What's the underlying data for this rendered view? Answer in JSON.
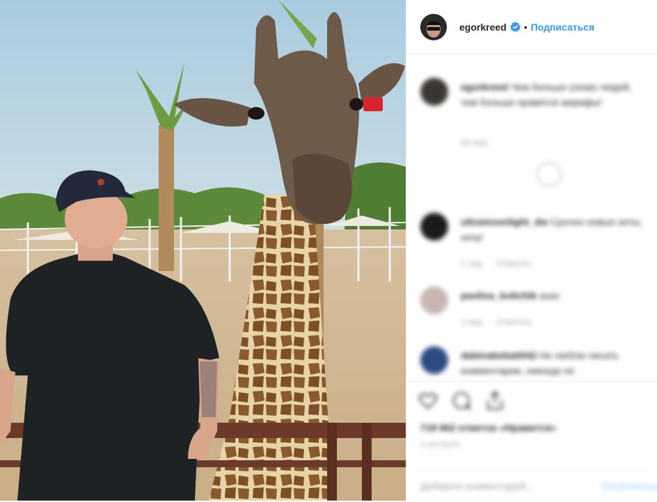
{
  "post": {
    "image_alt": "Man in black cap and t-shirt standing next to a giraffe at a zoo",
    "colors": {
      "accent": "#3897f0",
      "sky": "#bcd6e3",
      "ground": "#d2b48c"
    }
  },
  "header": {
    "username": "egorkreed",
    "verified_icon": "verified-badge-icon",
    "separator": "•",
    "follow_label": "Подписаться"
  },
  "comments": [
    {
      "user": "egorkreed",
      "text": "Чем больше узнаю людей, тем больше нравятся жирафы!",
      "meta_time": "33 нед."
    },
    {
      "user": "ultramoonlight_dw",
      "text": "Срочно новые хиты, хочу!",
      "meta_time": "1 нед.",
      "meta_reply": "Ответить"
    },
    {
      "user": "pavlina_koltchik",
      "text": "ахах",
      "meta_time": "1 нед.",
      "meta_reply": "Ответить"
    },
    {
      "user": "dabinabeba0042",
      "text": "Не люблю писать комментарии, никогда не",
      "meta_time": "",
      "meta_reply": ""
    }
  ],
  "actions": {
    "like_icon": "heart-icon",
    "comment_icon": "comment-icon",
    "share_icon": "share-icon",
    "likes_text": "718 662 отметок «Нравится»",
    "timestamp": "3 ОКТЯБРЯ"
  },
  "add_comment": {
    "placeholder": "Добавьте комментарий...",
    "publish_label": "Опубликовать"
  }
}
